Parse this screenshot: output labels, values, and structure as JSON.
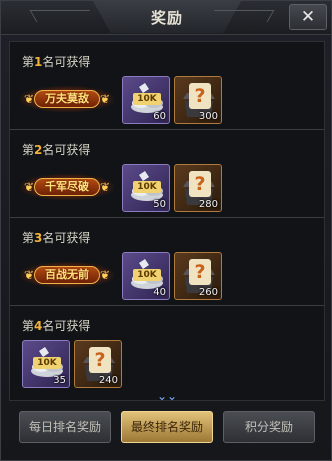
{
  "window": {
    "title": "奖励",
    "close_symbol": "✕"
  },
  "sections": [
    {
      "rank_prefix": "第",
      "rank_number": "1",
      "rank_suffix": "名可获得",
      "title_badge": "万夫莫敌",
      "items": [
        {
          "type": "silver",
          "badge": "10K",
          "count": "60"
        },
        {
          "type": "mystery",
          "symbol": "?",
          "count": "300"
        }
      ]
    },
    {
      "rank_prefix": "第",
      "rank_number": "2",
      "rank_suffix": "名可获得",
      "title_badge": "千军尽破",
      "items": [
        {
          "type": "silver",
          "badge": "10K",
          "count": "50"
        },
        {
          "type": "mystery",
          "symbol": "?",
          "count": "280"
        }
      ]
    },
    {
      "rank_prefix": "第",
      "rank_number": "3",
      "rank_suffix": "名可获得",
      "title_badge": "百战无前",
      "items": [
        {
          "type": "silver",
          "badge": "10K",
          "count": "40"
        },
        {
          "type": "mystery",
          "symbol": "?",
          "count": "260"
        }
      ]
    },
    {
      "rank_prefix": "第",
      "rank_number": "4",
      "rank_suffix": "名可获得",
      "title_badge": "",
      "items": [
        {
          "type": "silver",
          "badge": "10K",
          "count": "35"
        },
        {
          "type": "mystery",
          "symbol": "?",
          "count": "240"
        }
      ]
    }
  ],
  "scroll_indicator": "⌄⌄",
  "tabs": [
    {
      "label": "每日排名奖励",
      "state": "inactive"
    },
    {
      "label": "最终排名奖励",
      "state": "active"
    },
    {
      "label": "积分奖励",
      "state": "inactive"
    }
  ],
  "colors": {
    "accent_gold": "#f2b23a",
    "active_tab": "#e2c27a",
    "silver_slot": "#5b4a8a",
    "mystery_slot": "#5a3a1e"
  }
}
